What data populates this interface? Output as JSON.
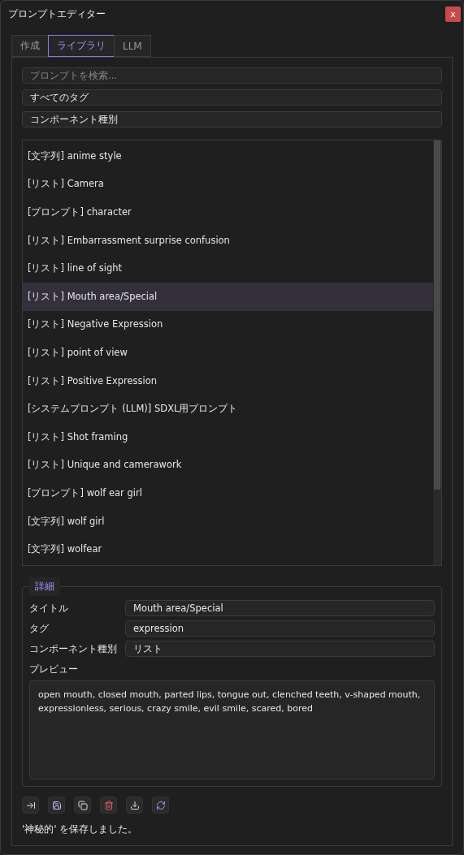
{
  "window": {
    "title": "プロンプトエディター",
    "close": "x"
  },
  "tabs": [
    {
      "label": "作成",
      "selected": false
    },
    {
      "label": "ライブラリ",
      "selected": true
    },
    {
      "label": "LLM",
      "selected": false
    }
  ],
  "search": {
    "placeholder": "プロンプトを検索..."
  },
  "tag_filter": {
    "value": "すべてのタグ"
  },
  "type_filter": {
    "value": "コンポーネント種別"
  },
  "library": [
    {
      "label": "[文字列] anime style",
      "selected": false
    },
    {
      "label": "[リスト] Camera",
      "selected": false
    },
    {
      "label": "[プロンプト] character",
      "selected": false
    },
    {
      "label": "[リスト] Embarrassment surprise confusion",
      "selected": false
    },
    {
      "label": "[リスト] line of sight",
      "selected": false
    },
    {
      "label": "[リスト] Mouth area/Special",
      "selected": true
    },
    {
      "label": "[リスト] Negative Expression",
      "selected": false
    },
    {
      "label": "[リスト] point of view",
      "selected": false
    },
    {
      "label": "[リスト] Positive Expression",
      "selected": false
    },
    {
      "label": "[システムプロンプト (LLM)] SDXL用プロンプト",
      "selected": false
    },
    {
      "label": "[リスト] Shot framing",
      "selected": false
    },
    {
      "label": "[リスト] Unique and camerawork",
      "selected": false
    },
    {
      "label": "[プロンプト] wolf ear girl",
      "selected": false
    },
    {
      "label": "[文字列] wolf girl",
      "selected": false
    },
    {
      "label": "[文字列] wolfear",
      "selected": false
    }
  ],
  "details": {
    "legend": "詳細",
    "fields": [
      {
        "label": "タイトル",
        "value": "Mouth area/Special"
      },
      {
        "label": "タグ",
        "value": "expression"
      },
      {
        "label": "コンポーネント種別",
        "value": "リスト"
      }
    ],
    "preview_label": "プレビュー",
    "preview": "open mouth, closed mouth, parted lips, tongue out, clenched teeth, v-shaped mouth, expressionless, serious, crazy smile, evil smile, scared, bored"
  },
  "toolbar": [
    {
      "kind": "insert"
    },
    {
      "kind": "save"
    },
    {
      "kind": "copy"
    },
    {
      "kind": "delete"
    },
    {
      "kind": "download"
    },
    {
      "kind": "reload"
    }
  ],
  "status": "'神秘的' を保存しました。"
}
